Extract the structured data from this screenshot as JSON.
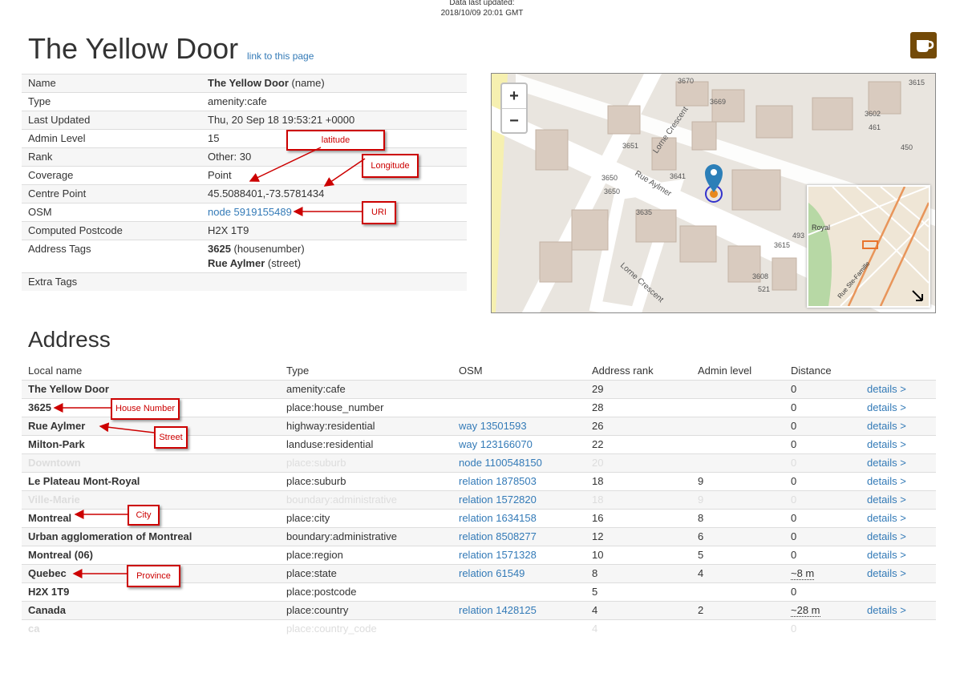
{
  "header": {
    "updated_label": "Data last updated:",
    "updated_value": "2018/10/09 20:01 GMT"
  },
  "title": "The Yellow Door",
  "permalink": "link to this page",
  "info": {
    "name_label": "Name",
    "name_value": "The Yellow Door",
    "name_suffix": "(name)",
    "type_label": "Type",
    "type_value": "amenity:cafe",
    "updated_label": "Last Updated",
    "updated_value": "Thu, 20 Sep 18 19:53:21 +0000",
    "admin_label": "Admin Level",
    "admin_value": "15",
    "rank_label": "Rank",
    "rank_value": "Other: 30",
    "coverage_label": "Coverage",
    "coverage_value": "Point",
    "centre_label": "Centre Point",
    "centre_value": "45.5088401,-73.5781434",
    "osm_label": "OSM",
    "osm_value": "node 5919155489",
    "postcode_label": "Computed Postcode",
    "postcode_value": "H2X 1T9",
    "address_tags_label": "Address Tags",
    "tag1_value": "3625",
    "tag1_suffix": "(housenumber)",
    "tag2_value": "Rue Aylmer",
    "tag2_suffix": "(street)",
    "extra_label": "Extra Tags"
  },
  "map": {
    "zoom_in": "+",
    "zoom_out": "−",
    "labels": [
      "3670",
      "3669",
      "3651",
      "3641",
      "3650",
      "3650",
      "3635",
      "3615",
      "3602",
      "461",
      "450",
      "3608",
      "521",
      "493",
      "3615",
      "Lorne Crescent",
      "Rue Aylmer",
      "Lorne Crescent",
      "Royal",
      "Rue Ste-Famille"
    ]
  },
  "address": {
    "heading": "Address",
    "columns": [
      "Local name",
      "Type",
      "OSM",
      "Address rank",
      "Admin level",
      "Distance",
      ""
    ],
    "rows": [
      {
        "name": "The Yellow Door",
        "type": "amenity:cafe",
        "osm": "",
        "rank": "29",
        "admin": "",
        "distance": "0",
        "details": "details >"
      },
      {
        "name": "3625",
        "type": "place:house_number",
        "osm": "",
        "rank": "28",
        "admin": "",
        "distance": "0",
        "details": "details >"
      },
      {
        "name": "Rue Aylmer",
        "type": "highway:residential",
        "osm": "way 13501593",
        "rank": "26",
        "admin": "",
        "distance": "0",
        "details": "details >"
      },
      {
        "name": "Milton-Park",
        "type": "landuse:residential",
        "osm": "way 123166070",
        "rank": "22",
        "admin": "",
        "distance": "0",
        "details": "details >"
      },
      {
        "name": "Downtown",
        "type": "place:suburb",
        "osm": "node 1100548150",
        "rank": "20",
        "admin": "",
        "distance": "0",
        "details": "details >"
      },
      {
        "name": "Le Plateau Mont-Royal",
        "type": "place:suburb",
        "osm": "relation 1878503",
        "rank": "18",
        "admin": "9",
        "distance": "0",
        "details": "details >"
      },
      {
        "name": "Ville-Marie",
        "type": "boundary:administrative",
        "osm": "relation 1572820",
        "rank": "18",
        "admin": "9",
        "distance": "0",
        "details": "details >"
      },
      {
        "name": "Montreal",
        "type": "place:city",
        "osm": "relation 1634158",
        "rank": "16",
        "admin": "8",
        "distance": "0",
        "details": "details >"
      },
      {
        "name": "Urban agglomeration of Montreal",
        "type": "boundary:administrative",
        "osm": "relation 8508277",
        "rank": "12",
        "admin": "6",
        "distance": "0",
        "details": "details >"
      },
      {
        "name": "Montreal (06)",
        "type": "place:region",
        "osm": "relation 1571328",
        "rank": "10",
        "admin": "5",
        "distance": "0",
        "details": "details >"
      },
      {
        "name": "Quebec",
        "type": "place:state",
        "osm": "relation 61549",
        "rank": "8",
        "admin": "4",
        "distance": "~8 m",
        "details": "details >"
      },
      {
        "name": "H2X 1T9",
        "type": "place:postcode",
        "osm": "",
        "rank": "5",
        "admin": "",
        "distance": "0",
        "details": ""
      },
      {
        "name": "Canada",
        "type": "place:country",
        "osm": "relation 1428125",
        "rank": "4",
        "admin": "2",
        "distance": "~28 m",
        "details": "details >"
      },
      {
        "name": "ca",
        "type": "place:country_code",
        "osm": "",
        "rank": "4",
        "admin": "",
        "distance": "0",
        "details": ""
      }
    ]
  },
  "annotations": {
    "latitude": "latitude",
    "longitude": "Longitude",
    "uri": "URI",
    "house_number": "House Number",
    "street": "Street",
    "city": "City",
    "province": "Province"
  },
  "colors": {
    "link": "#337ab7",
    "annotation": "#cc0000",
    "cafe_icon": "#734a08",
    "marker": "#2c7fb8"
  }
}
